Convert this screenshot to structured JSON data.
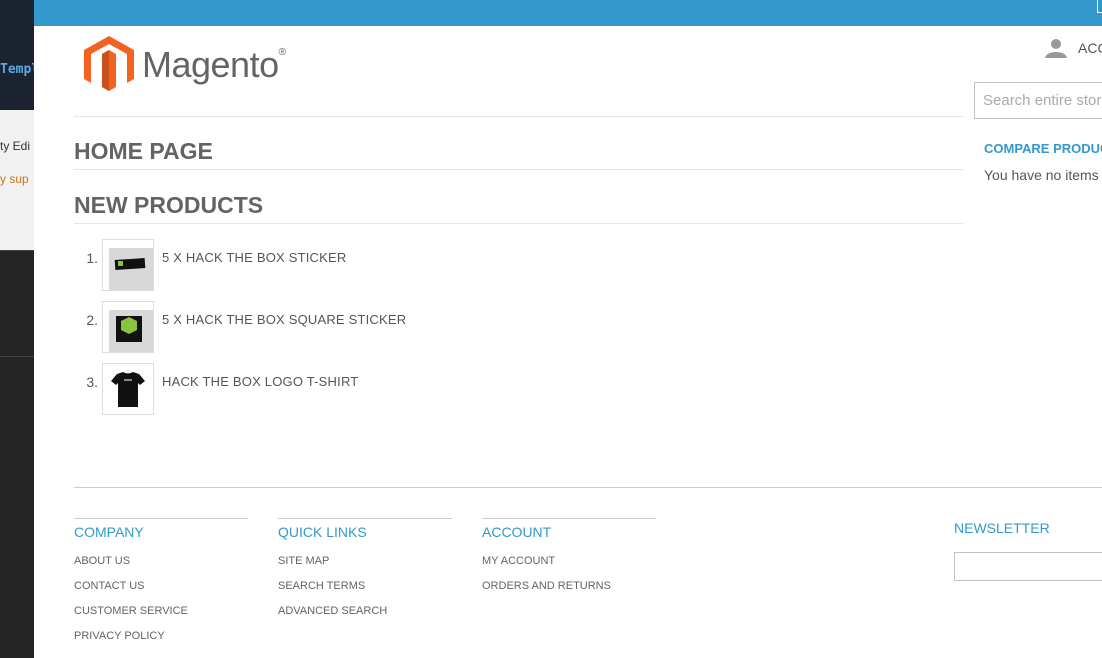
{
  "background_app": {
    "code_fragment": "Templ",
    "line1": "ty Edi",
    "line2": "y sup"
  },
  "header": {
    "logo_text": "Magento",
    "logo_reg": "®",
    "account_label": "ACC",
    "search_placeholder": "Search entire store here..."
  },
  "main": {
    "page_title": "HOME PAGE",
    "section_title": "NEW PRODUCTS",
    "products": [
      {
        "num": "1.",
        "name": "5 X HACK THE BOX STICKER"
      },
      {
        "num": "2.",
        "name": "5 X HACK THE BOX SQUARE STICKER"
      },
      {
        "num": "3.",
        "name": "HACK THE BOX LOGO T-SHIRT"
      }
    ]
  },
  "sidebar": {
    "compare_title": "COMPARE PRODUCTS",
    "compare_empty": "You have no items to compare."
  },
  "footer": {
    "columns": [
      {
        "title": "COMPANY",
        "links": [
          "ABOUT US",
          "CONTACT US",
          "CUSTOMER SERVICE",
          "PRIVACY POLICY"
        ]
      },
      {
        "title": "QUICK LINKS",
        "links": [
          "SITE MAP",
          "SEARCH TERMS",
          "ADVANCED SEARCH"
        ]
      },
      {
        "title": "ACCOUNT",
        "links": [
          "MY ACCOUNT",
          "ORDERS AND RETURNS"
        ]
      }
    ],
    "newsletter_title": "NEWSLETTER"
  },
  "colors": {
    "accent": "#3399cc",
    "logo_orange": "#f26322",
    "text": "#636363"
  }
}
